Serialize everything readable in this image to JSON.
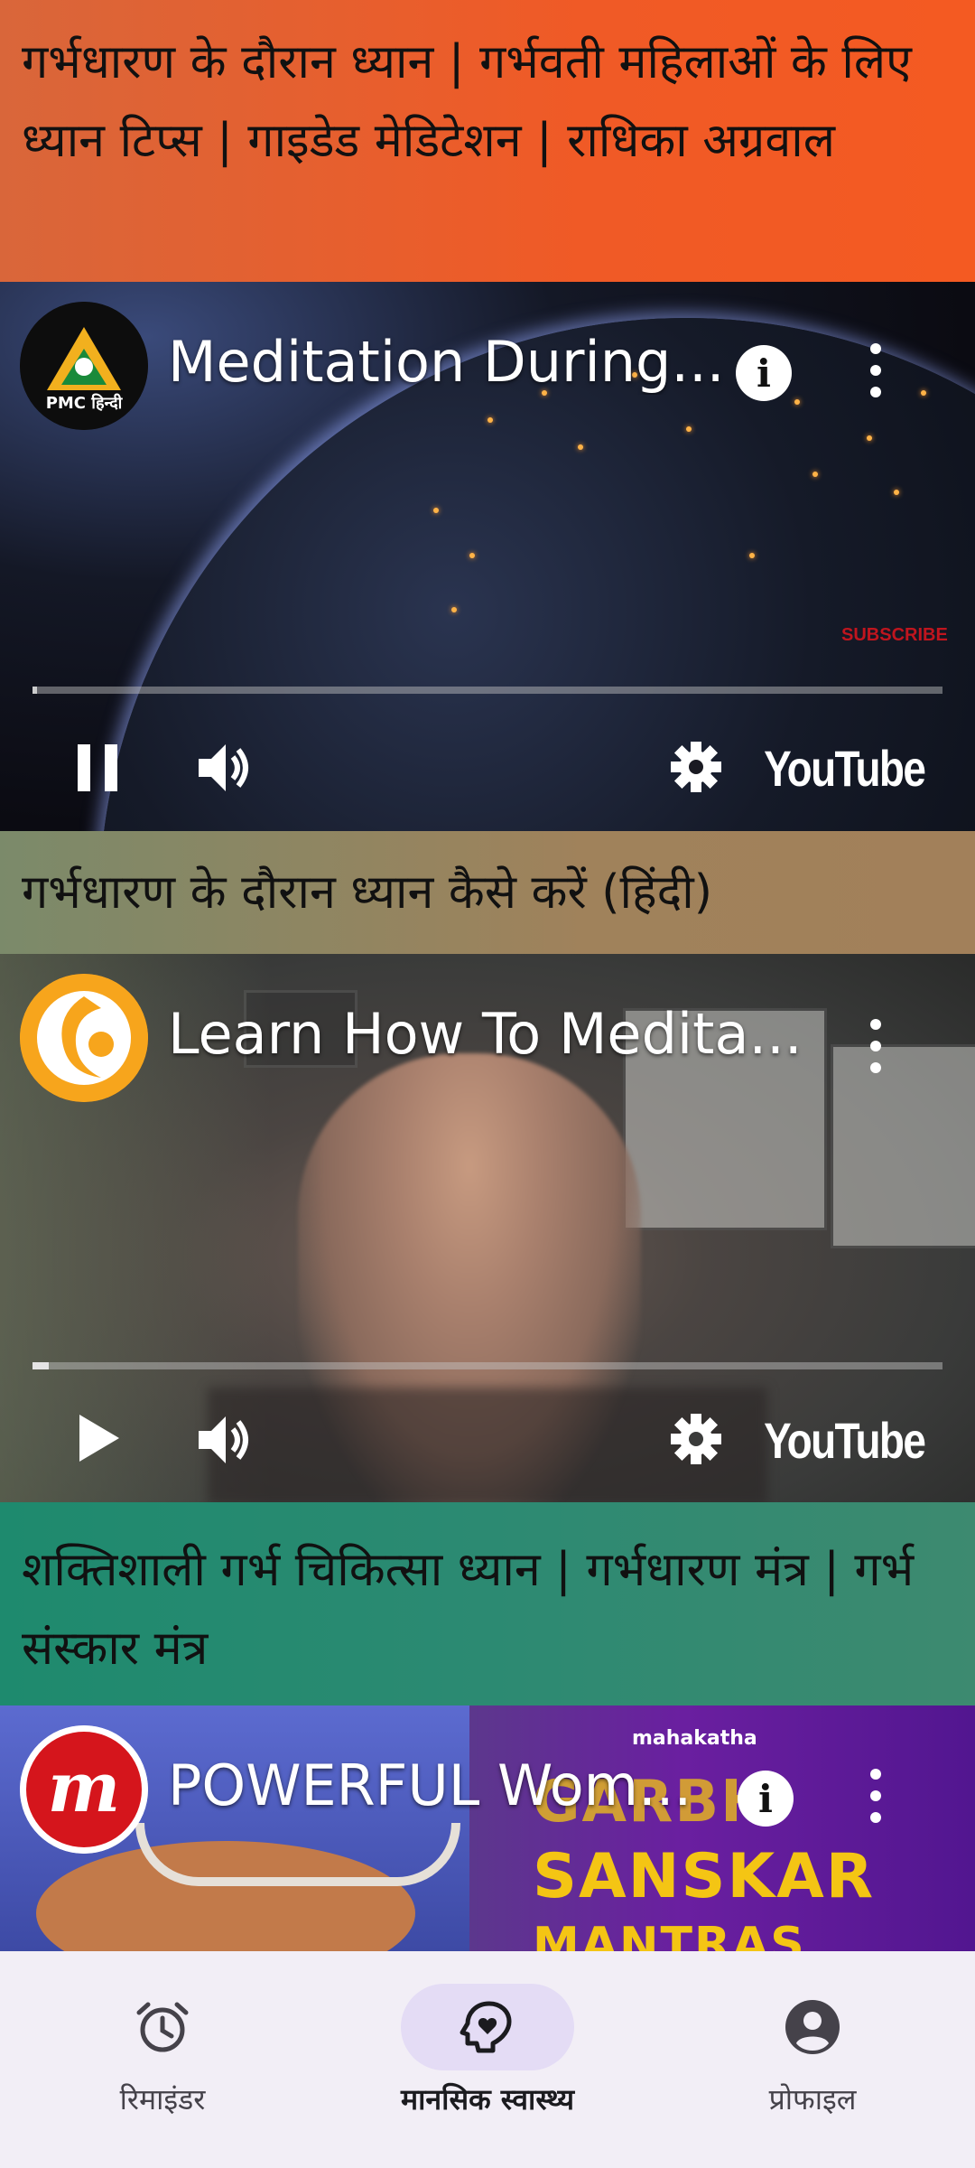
{
  "sections": [
    {
      "title": "गर्भधारण के दौरान ध्यान | गर्भवती महिलाओं के लिए ध्यान टिप्स | गाइडेड मेडिटेशन | राधिका अग्रवाल",
      "video": {
        "channel_logo_text": "PMC हिन्दी",
        "title": "Meditation During...",
        "overlay_text": "SUBSCRIBE",
        "playback_state": "playing",
        "progress": 0.0,
        "youtube_label": "YouTube"
      }
    },
    {
      "title": "गर्भधारण के दौरान ध्यान कैसे करें (हिंदी)",
      "video": {
        "title": "Learn How To Medita...",
        "playback_state": "paused",
        "progress": 0.02,
        "youtube_label": "YouTube"
      }
    },
    {
      "title": "शक्तिशाली गर्भ चिकित्सा ध्यान | गर्भधारण मंत्र | गर्भ संस्कार मंत्र",
      "video": {
        "channel_logo_text": "m",
        "title": "POWERFUL Wom...",
        "thumbnail_brand": "mahakatha",
        "thumbnail_lines": [
          "GARBH",
          "SANSKAR",
          "MANTRAS"
        ]
      }
    }
  ],
  "bottom_nav": {
    "items": [
      {
        "label": "रिमाइंडर",
        "icon": "alarm-clock-icon",
        "active": false
      },
      {
        "label": "मानसिक स्वास्थ्य",
        "icon": "mental-health-icon",
        "active": true
      },
      {
        "label": "प्रोफाइल",
        "icon": "account-circle-icon",
        "active": false
      }
    ]
  },
  "colors": {
    "active_pill": "#e4dcf5",
    "subscribe_red": "#c0151e",
    "mantra_yellow": "#f4c514"
  }
}
